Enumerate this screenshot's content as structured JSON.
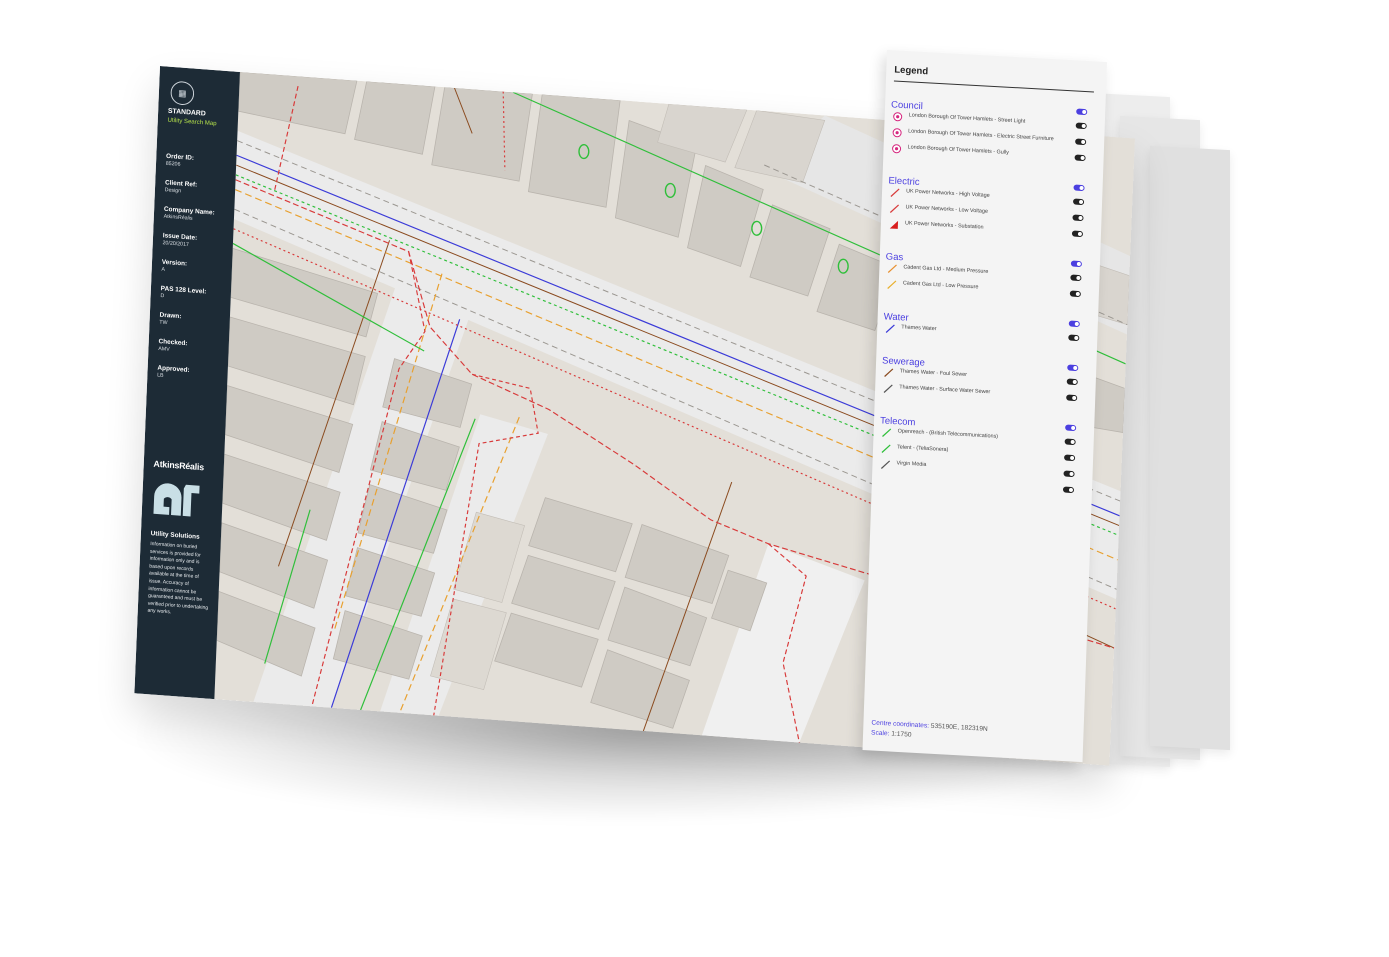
{
  "sidebar": {
    "product": "STANDARD",
    "product_sub": "Utility Search Map",
    "fields": [
      {
        "label": "Order ID:",
        "value": "85206"
      },
      {
        "label": "Client Ref:",
        "value": "Design"
      },
      {
        "label": "Company Name:",
        "value": "AtkinsRéalis"
      },
      {
        "label": "Issue Date:",
        "value": "20/20/2017"
      },
      {
        "label": "Version:",
        "value": "A"
      },
      {
        "label": "PAS 128 Level:",
        "value": "D"
      },
      {
        "label": "Drawn:",
        "value": "TW"
      },
      {
        "label": "Checked:",
        "value": "AMV"
      },
      {
        "label": "Approved:",
        "value": "LB"
      }
    ],
    "brand": "AtkinsRéalis",
    "section_title": "Utility Solutions",
    "disclaimer": "Information on buried services is provided for information only and is based upon records available at the time of issue. Accuracy of information cannot be guaranteed and must be verified prior to undertaking any works."
  },
  "legend": {
    "title": "Legend",
    "groups": [
      {
        "name": "Council",
        "on": true,
        "items": [
          {
            "label": "London Borough Of Tower Hamlets - Street Light",
            "icon": "street-light-pin-icon",
            "color": "#d6277f",
            "on": false
          },
          {
            "label": "London Borough Of Tower Hamlets - Electric Street Furniture",
            "icon": "electric-furniture-pin-icon",
            "color": "#d6277f",
            "on": false
          },
          {
            "label": "London Borough Of Tower Hamlets - Gully",
            "icon": "gully-pin-icon",
            "color": "#d6277f",
            "on": false
          }
        ]
      },
      {
        "name": "Electric",
        "on": true,
        "items": [
          {
            "label": "UK Power Networks - High Voltage",
            "icon": "line-icon",
            "color": "#d83a3a",
            "on": false
          },
          {
            "label": "UK Power Networks - Low Voltage",
            "icon": "line-icon",
            "color": "#d83a3a",
            "on": false
          },
          {
            "label": "UK Power Networks - Substation",
            "icon": "triangle-icon",
            "color": "#d81e1e",
            "on": false
          }
        ]
      },
      {
        "name": "Gas",
        "on": true,
        "items": [
          {
            "label": "Cadent Gas Ltd - Medium Pressure",
            "icon": "line-icon",
            "color": "#e8902f",
            "on": false
          },
          {
            "label": "Cadent Gas Ltd - Low Pressure",
            "icon": "line-icon",
            "color": "#e8b02f",
            "on": false
          }
        ]
      },
      {
        "name": "Water",
        "on": true,
        "items": [
          {
            "label": "Thames Water",
            "icon": "line-icon",
            "color": "#3a3ad8",
            "on": false
          }
        ]
      },
      {
        "name": "Sewerage",
        "on": true,
        "items": [
          {
            "label": "Thames Water - Foul Sewer",
            "icon": "line-icon",
            "color": "#8a4a1e",
            "on": false
          },
          {
            "label": "Thames Water - Surface Water Sewer",
            "icon": "line-icon",
            "color": "#555555",
            "on": false
          }
        ]
      },
      {
        "name": "Telecom",
        "on": true,
        "items": [
          {
            "label": "Openreach - (British Telecommunications)",
            "icon": "line-icon",
            "color": "#2fbf3a",
            "on": false
          },
          {
            "label": "Telent - (TeliaSonera)",
            "icon": "line-icon",
            "color": "#2fbf3a",
            "on": false
          },
          {
            "label": "Virgin Media",
            "icon": "line-icon",
            "color": "#555555",
            "on": false
          }
        ]
      }
    ],
    "extra_toggle_on": false,
    "coords_label": "Centre coordinates:",
    "coords_value": "535190E, 182319N",
    "scale_label": "Scale:",
    "scale_value": "1:1750"
  },
  "colors": {
    "sidebar_bg": "#1d2b36",
    "accent_green": "#b4e14b",
    "legend_accent": "#4b3fe0",
    "water": "#3a3ad8",
    "electric": "#d83a3a",
    "gas": "#e8a02f",
    "telecom": "#2fbf3a",
    "sewer": "#8a4a1e"
  }
}
